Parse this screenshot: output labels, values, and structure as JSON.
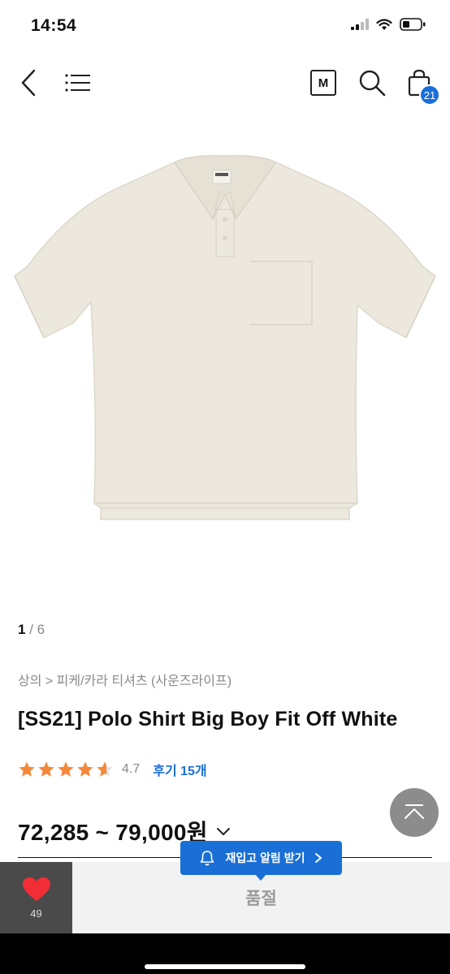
{
  "status_bar": {
    "time": "14:54",
    "icons": [
      "signal-icon",
      "wifi-icon",
      "battery-icon"
    ]
  },
  "nav": {
    "back_icon": "chevron-left-icon",
    "menu_icon": "hamburger-menu-icon",
    "m_badge": "M",
    "search_icon": "search-icon",
    "cart_icon": "shopping-bag-icon",
    "cart_count": "21"
  },
  "product": {
    "image": "polo-shirt-off-white",
    "pager": {
      "current": "1",
      "total": " / 6"
    },
    "breadcrumb": "상의 > 피케/카라 티셔츠 (사운즈라이프)",
    "title": "[SS21] Polo Shirt Big Boy Fit Off White",
    "rating": {
      "stars": 4.7,
      "value": "4.7",
      "reviews": "후기 15개"
    },
    "price": "72,285 ~ 79,000원"
  },
  "bottom": {
    "like_count": "49",
    "restock_label": "재입고 알림 받기",
    "status": "품절"
  },
  "colors": {
    "accent": "#1a6fd6",
    "star": "#f4873a",
    "shirt": "#ece8de"
  }
}
